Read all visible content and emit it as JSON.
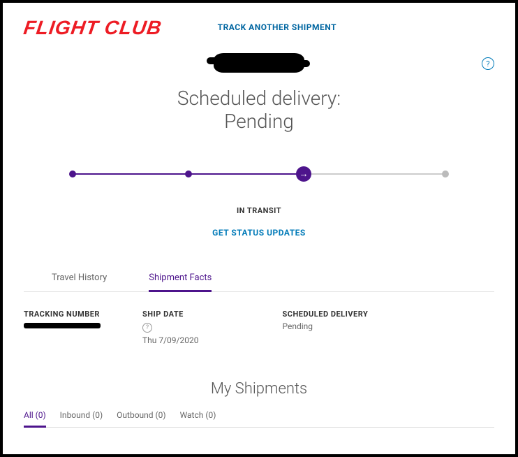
{
  "logo": "FLIGHT CLUB",
  "track_another": "TRACK ANOTHER SHIPMENT",
  "scheduled": {
    "title": "Scheduled delivery:",
    "value": "Pending"
  },
  "status_label": "IN TRANSIT",
  "get_status": "GET STATUS UPDATES",
  "progress": {
    "step": 3,
    "total": 4
  },
  "tabs": {
    "travel_history": "Travel History",
    "shipment_facts": "Shipment Facts",
    "active": "shipment_facts"
  },
  "facts": {
    "tracking_number_label": "TRACKING NUMBER",
    "ship_date_label": "SHIP DATE",
    "ship_date_value": "Thu 7/09/2020",
    "scheduled_delivery_label": "SCHEDULED DELIVERY",
    "scheduled_delivery_value": "Pending"
  },
  "my_shipments_title": "My Shipments",
  "ship_tabs": [
    {
      "label": "All (0)",
      "active": true
    },
    {
      "label": "Inbound (0)",
      "active": false
    },
    {
      "label": "Outbound (0)",
      "active": false
    },
    {
      "label": "Watch (0)",
      "active": false
    }
  ],
  "colors": {
    "brand_purple": "#4d148c",
    "link_blue": "#007ab8",
    "logo_red": "#ed1c24"
  }
}
